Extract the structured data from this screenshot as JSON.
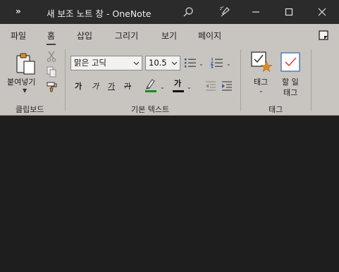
{
  "window": {
    "title": "새 보조 노트 창  -  OneNote",
    "more_glyph": "»"
  },
  "tabs": [
    {
      "label": "파일"
    },
    {
      "label": "홈"
    },
    {
      "label": "삽입"
    },
    {
      "label": "그리기"
    },
    {
      "label": "보기"
    },
    {
      "label": "페이지"
    }
  ],
  "ribbon": {
    "clipboard": {
      "paste_label": "붙여넣기",
      "group_label": "클립보드"
    },
    "basic_text": {
      "font_name": "맑은 고딕",
      "font_size": "10.5",
      "bold": "가",
      "italic": "가",
      "underline": "가",
      "strike": "가",
      "font_color_glyph": "가",
      "group_label": "기본 텍스트"
    },
    "tags": {
      "tag_label": "태그",
      "todo_label_line1": "할 일",
      "todo_label_line2": "태그",
      "group_label": "태그"
    }
  },
  "colors": {
    "titlebar": "#2b2b2b",
    "ribbon": "#c8c4bf",
    "canvas": "#1e1e1e",
    "highlight_green": "#1a8c1a",
    "todo_check": "#d24a55",
    "tag_star": "#e08a1e"
  }
}
